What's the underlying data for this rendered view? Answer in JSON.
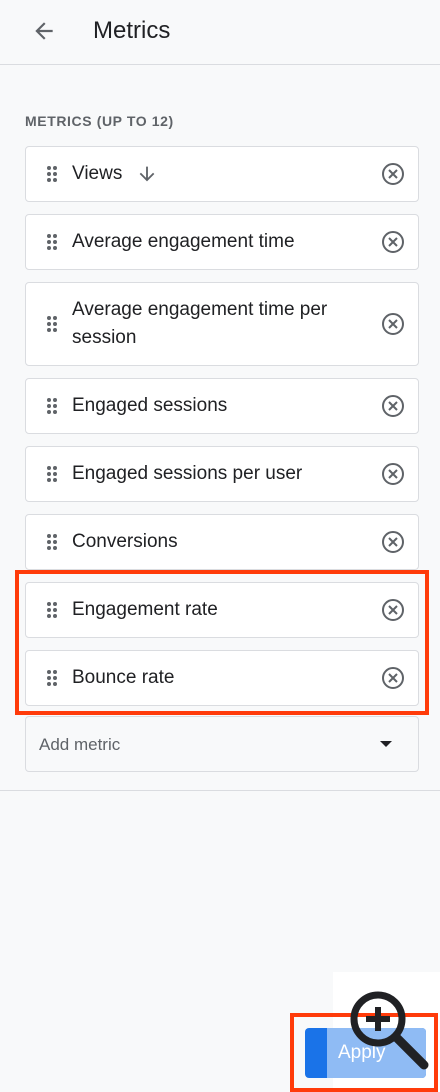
{
  "header": {
    "title": "Metrics",
    "back_icon": "arrow-left-icon"
  },
  "section": {
    "label": "METRICS (UP TO 12)"
  },
  "metrics": [
    {
      "label": "Views",
      "sorted": true
    },
    {
      "label": "Average engagement time"
    },
    {
      "label": "Average engagement time per session"
    },
    {
      "label": "Engaged sessions"
    },
    {
      "label": "Engaged sessions per user"
    },
    {
      "label": "Conversions"
    },
    {
      "label": "Engagement rate"
    },
    {
      "label": "Bounce rate"
    }
  ],
  "add_metric": {
    "label": "Add metric"
  },
  "apply": {
    "label": "Apply"
  },
  "colors": {
    "accent": "#1a73e8",
    "highlight": "#ff3b0a"
  }
}
